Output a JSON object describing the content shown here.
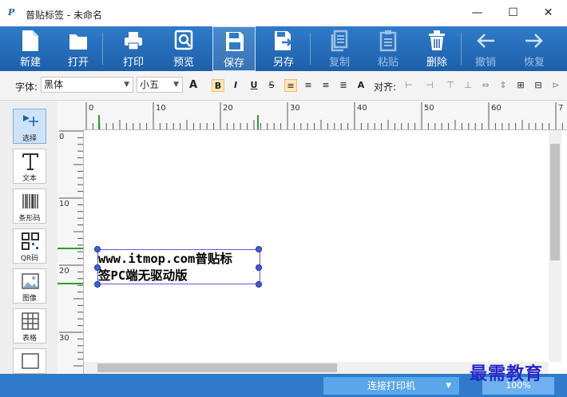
{
  "window": {
    "app_icon_text": "P",
    "title": "普贴标签 - 未命名",
    "controls": {
      "minimize": "—",
      "maximize": "☐",
      "close": "✕"
    }
  },
  "ribbon": {
    "buttons": [
      {
        "label": "新建",
        "icon": "new-file-icon"
      },
      {
        "label": "打开",
        "icon": "folder-icon"
      },
      {
        "label": "打印",
        "icon": "printer-icon"
      },
      {
        "label": "预览",
        "icon": "preview-icon"
      },
      {
        "label": "保存",
        "icon": "save-icon"
      },
      {
        "label": "另存",
        "icon": "save-as-icon"
      },
      {
        "label": "复制",
        "icon": "copy-icon"
      },
      {
        "label": "粘贴",
        "icon": "paste-icon"
      },
      {
        "label": "删除",
        "icon": "trash-icon"
      },
      {
        "label": "撤销",
        "icon": "undo-arrow-icon"
      },
      {
        "label": "恢复",
        "icon": "redo-arrow-icon"
      }
    ]
  },
  "format": {
    "font_label": "字体:",
    "font_value": "黑体",
    "size_value": "小五",
    "align_label": "对齐:",
    "style_buttons": [
      "A",
      "B",
      "I",
      "U",
      "S"
    ]
  },
  "tools": [
    {
      "label": "选择",
      "icon": "select-pointer-icon"
    },
    {
      "label": "文本",
      "icon": "text-tool-icon"
    },
    {
      "label": "条形码",
      "icon": "barcode-icon"
    },
    {
      "label": "QR码",
      "icon": "qr-code-icon"
    },
    {
      "label": "图像",
      "icon": "image-icon"
    },
    {
      "label": "表格",
      "icon": "table-icon"
    }
  ],
  "ruler": {
    "top_numbers": [
      "0",
      "10",
      "20",
      "30",
      "40",
      "50",
      "60",
      "7"
    ],
    "left_numbers": [
      "0",
      "10",
      "20",
      "30"
    ]
  },
  "canvas": {
    "text_line1": "www.itmop.com普贴标",
    "text_line2": "签PC端无驱动版"
  },
  "status": {
    "connect_printer": "连接打印机",
    "zoom": "100%"
  },
  "watermark": "最需教育"
}
